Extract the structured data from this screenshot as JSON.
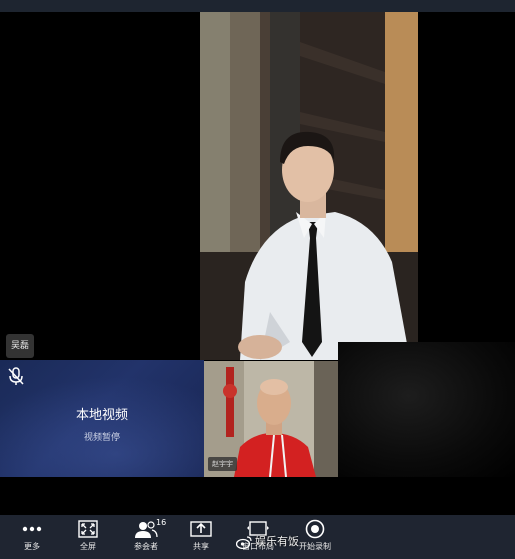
{
  "main_video": {
    "participant_name": "吴磊"
  },
  "local_video": {
    "title": "本地视频",
    "status": "视频暂停"
  },
  "thumbnail": {
    "participant_name": "赵宇宇"
  },
  "toolbar": {
    "items": [
      {
        "label": "更多",
        "icon": "more-dots-icon"
      },
      {
        "label": "全屏",
        "icon": "fullscreen-icon"
      },
      {
        "label": "参会者",
        "icon": "participants-icon",
        "count": "16"
      },
      {
        "label": "共享",
        "icon": "share-screen-icon"
      },
      {
        "label": "窗口布局",
        "icon": "layout-icon"
      },
      {
        "label": "开始录制",
        "icon": "record-icon"
      }
    ]
  },
  "watermark": {
    "text": "娱乐有饭"
  },
  "colors": {
    "toolbar_bg": "#1f2531",
    "local_panel_bg": "#1f2f60",
    "text": "#ffffff"
  }
}
